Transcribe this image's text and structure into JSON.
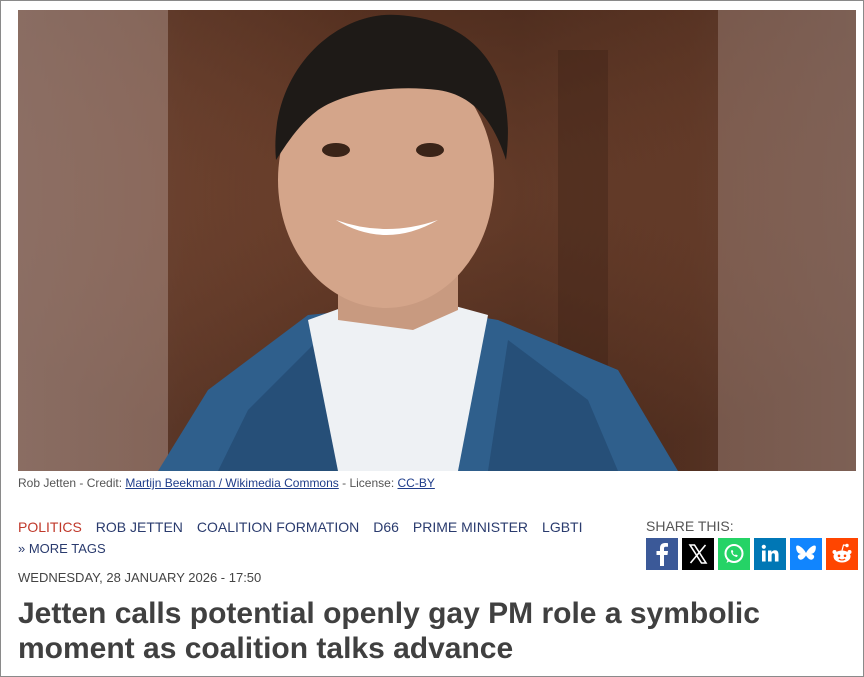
{
  "photo": {
    "alt": "Rob Jetten",
    "caption_prefix": "Rob Jetten - Credit: ",
    "credit_link": "Martijn Beekman / Wikimedia Commons",
    "license_prefix": " - License: ",
    "license_link": "CC-BY"
  },
  "tags": {
    "items": [
      "POLITICS",
      "ROB JETTEN",
      "COALITION FORMATION",
      "D66",
      "PRIME MINISTER",
      "LGBTI"
    ],
    "more": "» MORE TAGS"
  },
  "share": {
    "label": "SHARE THIS:",
    "buttons": [
      {
        "icon": "facebook-icon",
        "color": "#3b5998"
      },
      {
        "icon": "x-icon",
        "color": "#000000"
      },
      {
        "icon": "whatsapp-icon",
        "color": "#25d366"
      },
      {
        "icon": "linkedin-icon",
        "color": "#0077b5"
      },
      {
        "icon": "bluesky-icon",
        "color": "#1185fe"
      },
      {
        "icon": "reddit-icon",
        "color": "#ff4500"
      }
    ]
  },
  "article": {
    "date": "WEDNESDAY, 28 JANUARY 2026 - 17:50",
    "headline": "Jetten calls potential openly gay PM role a symbolic moment as coalition talks advance"
  }
}
